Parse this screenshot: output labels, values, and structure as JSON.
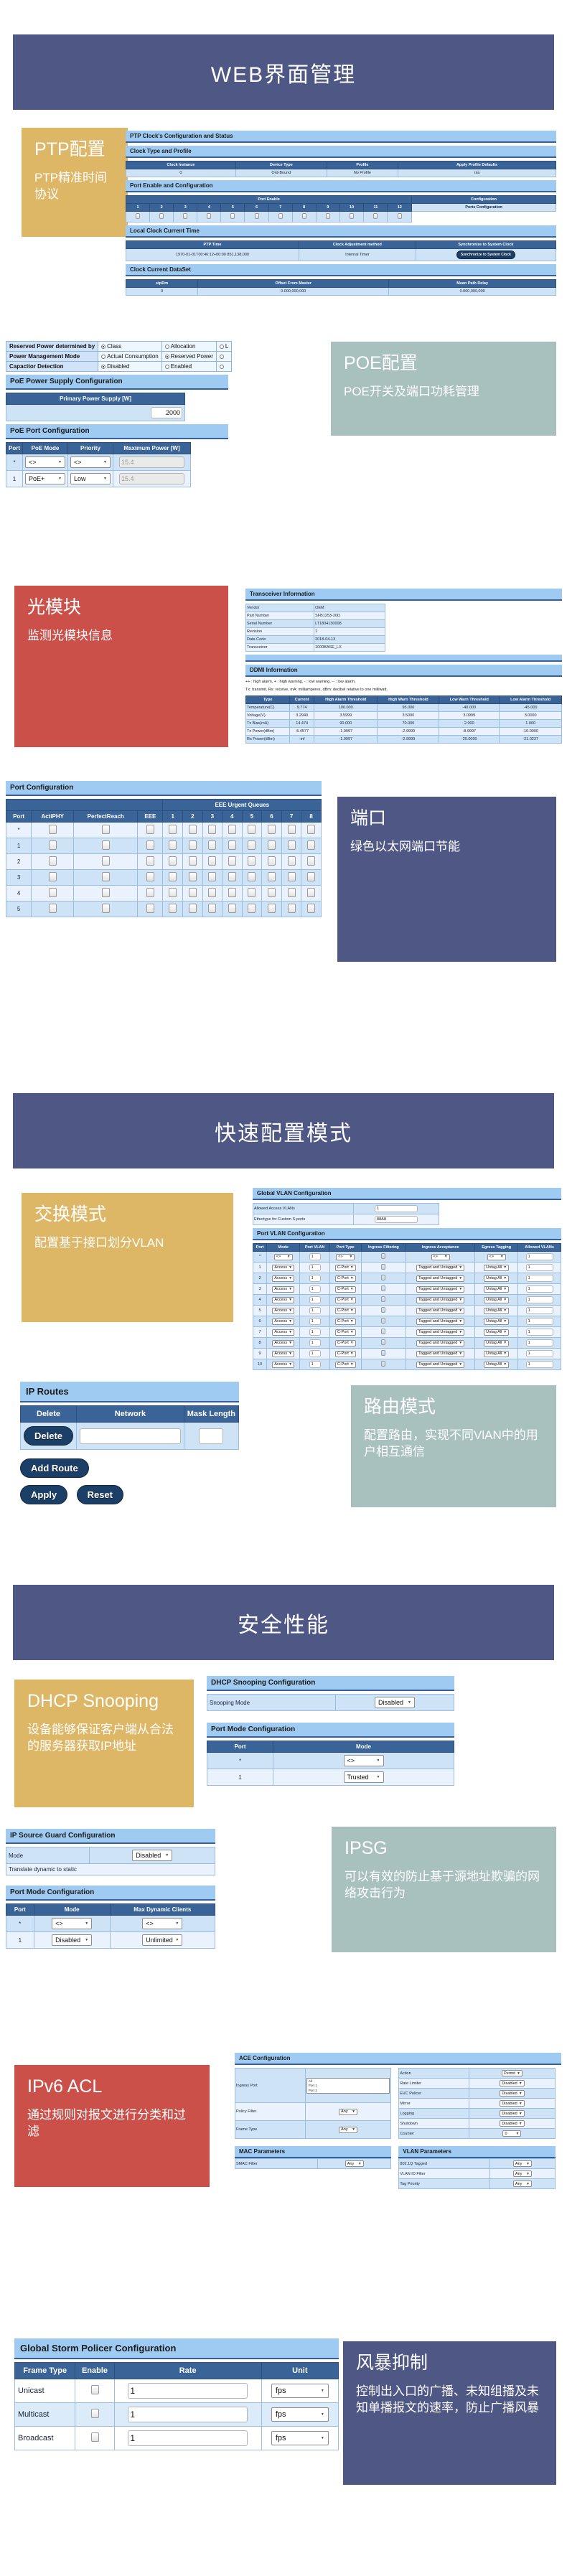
{
  "sections": [
    {
      "banner": "WEB界面管理"
    },
    {
      "banner": "快速配置模式"
    },
    {
      "banner": "安全性能"
    }
  ],
  "cards": {
    "ptp": {
      "title": "PTP配置",
      "sub": "PTP精准时间协议"
    },
    "poe": {
      "title": "POE配置",
      "sub": "POE开关及端口功耗管理"
    },
    "optic": {
      "title": "光模块",
      "sub": "监测光模块信息"
    },
    "port": {
      "title": "端口",
      "sub": "绿色以太网端口节能"
    },
    "switch": {
      "title": "交换模式",
      "sub": "配置基于接口划分VLAN"
    },
    "route": {
      "title": "路由模式",
      "sub": "配置路由，实现不同VlAN中的用户相互通信"
    },
    "dhcp": {
      "title": "DHCP Snooping",
      "sub": "设备能够保证客户端从合法的服务器获取IP地址"
    },
    "ipsg": {
      "title": "IPSG",
      "sub": "可以有效的防止基于源地址欺骗的网络攻击行为"
    },
    "acl": {
      "title": "IPv6 ACL",
      "sub": "通过规则对报文进行分类和过滤"
    },
    "storm": {
      "title": "风暴抑制",
      "sub": "控制出入口的广播、未知组播及未知单播报文的速率，防止广播风暴"
    }
  },
  "ptp": {
    "title": "PTP Clock's Configuration and Status",
    "clock_type_title": "Clock Type and Profile",
    "clock_type_headers": [
      "Clock Instance",
      "Device Type",
      "Profile",
      "Apply Profile Defaults"
    ],
    "clock_type_row": [
      "0",
      "Ord-Bound",
      "No Profile",
      "n/a"
    ],
    "port_enable_title": "Port Enable and Configuration",
    "port_enable_group": "Port Enable",
    "configuration_group": "Configuration",
    "ports": [
      "1",
      "2",
      "3",
      "4",
      "5",
      "6",
      "7",
      "8",
      "9",
      "10",
      "11",
      "12"
    ],
    "ports_config_label": "Ports Configuration",
    "local_clock_title": "Local Clock Current Time",
    "local_clock_headers": [
      "PTP Time",
      "Clock Adjustment method",
      "Synchronize to System Clock"
    ],
    "local_clock_time": "1970-01-01T00:46:12+00:00 851,138,000",
    "local_clock_method": "Internal Timer",
    "sync_button": "Synchronize to System Clock",
    "dataset_title": "Clock Current DataSet",
    "dataset_headers": [
      "stpRm",
      "Offset From Master",
      "Mean Path Delay"
    ],
    "dataset_row": [
      "0",
      "0.000,000,000",
      "0.000,000,000"
    ]
  },
  "poe": {
    "settings": [
      {
        "label": "Reserved Power determined by",
        "options": [
          {
            "text": "Class",
            "checked": true
          },
          {
            "text": "Allocation",
            "checked": false
          },
          {
            "text": "L",
            "checked": false
          }
        ]
      },
      {
        "label": "Power Management Mode",
        "options": [
          {
            "text": "Actual Consumption",
            "checked": false
          },
          {
            "text": "Reserved Power",
            "checked": true
          },
          {
            "text": "",
            "checked": false
          }
        ]
      },
      {
        "label": "Capacitor Detection",
        "options": [
          {
            "text": "Disabled",
            "checked": true
          },
          {
            "text": "Enabled",
            "checked": false
          },
          {
            "text": "",
            "checked": false
          }
        ]
      }
    ],
    "supply_title": "PoE Power Supply Configuration",
    "supply_header": "Primary Power Supply [W]",
    "supply_value": "2000",
    "port_title": "PoE Port Configuration",
    "port_headers": [
      "Port",
      "PoE Mode",
      "Priority",
      "Maximum Power [W]"
    ],
    "port_rows": [
      {
        "port": "*",
        "mode": "<>",
        "priority": "<>",
        "max": "15.4"
      },
      {
        "port": "1",
        "mode": "PoE+",
        "priority": "Low",
        "max": "15.4"
      }
    ]
  },
  "transceiver": {
    "title": "Transceiver Information",
    "rows": [
      [
        "Vendor",
        "OEM"
      ],
      [
        "Part Number",
        "SFB1253-20D"
      ],
      [
        "Serial Number",
        "LT1804130008"
      ],
      [
        "Revision",
        "1"
      ],
      [
        "Data Code",
        "2018-04-13"
      ],
      [
        "Transceiver",
        "1000BASE_LX"
      ]
    ],
    "ddmi_title": "DDMI Information",
    "legend1": "++ : high alarm, + : high warning, - : low warning, -- : low alarm.",
    "legend2": "Tx: transmit, Rx: receive, mA: milliamperes, dBm: decibel relative to one milliwatt.",
    "ddmi_headers": [
      "Type",
      "Current",
      "High Alarm Threshold",
      "High Warn Threshold",
      "Low Warn Threshold",
      "Low Alarm Threshold"
    ],
    "ddmi_rows": [
      [
        "Temperature(C)",
        "9.774",
        "100.000",
        "95.000",
        "-40.000",
        "-45.000"
      ],
      [
        "Voltage(V)",
        "3.2940",
        "3.5999",
        "3.5000",
        "3.0999",
        "3.0000"
      ],
      [
        "Tx Bias(mA)",
        "14.474",
        "90.000",
        "70.000",
        "2.000",
        "1.000"
      ],
      [
        "Tx Power(dBm)",
        "-5.4577",
        "-1.9997",
        "-2.9999",
        "-8.9997",
        "-10.0000"
      ],
      [
        "Rx Power(dBm)",
        "-inf",
        "-1.9997",
        "-2.9999",
        "-20.0000",
        "-21.0237"
      ]
    ]
  },
  "port_config": {
    "title": "Port Configuration",
    "group_header": "EEE Urgent Queues",
    "headers": [
      "Port",
      "ActiPHY",
      "PerfectReach",
      "EEE"
    ],
    "queues": [
      "1",
      "2",
      "3",
      "4",
      "5",
      "6",
      "7",
      "8"
    ],
    "rows": [
      "*",
      "1",
      "2",
      "3",
      "4",
      "5"
    ]
  },
  "vlan": {
    "global_title": "Global VLAN Configuration",
    "allowed_label": "Allowed Access VLANs",
    "allowed_value": "1",
    "ethertype_label": "Ethertype for Custom S-ports",
    "ethertype_value": "88A8",
    "port_title": "Port VLAN Configuration",
    "headers": [
      "Port",
      "Mode",
      "Port VLAN",
      "Port Type",
      "Ingress Filtering",
      "Ingress Acceptance",
      "Egress Tagging",
      "Allowed VLANs"
    ],
    "rows": [
      {
        "port": "*",
        "mode": "<>",
        "pvlan": "1",
        "ptype": "<>",
        "filter": true,
        "accept": "<>",
        "tag": "<>",
        "allowed": "1"
      },
      {
        "port": "1",
        "mode": "Access",
        "pvlan": "1",
        "ptype": "C-Port",
        "filter": true,
        "accept": "Tagged and Untagged",
        "tag": "Untag All",
        "allowed": "1"
      },
      {
        "port": "2",
        "mode": "Access",
        "pvlan": "1",
        "ptype": "C-Port",
        "filter": true,
        "accept": "Tagged and Untagged",
        "tag": "Untag All",
        "allowed": "1"
      },
      {
        "port": "3",
        "mode": "Access",
        "pvlan": "1",
        "ptype": "C-Port",
        "filter": true,
        "accept": "Tagged and Untagged",
        "tag": "Untag All",
        "allowed": "1"
      },
      {
        "port": "4",
        "mode": "Access",
        "pvlan": "1",
        "ptype": "C-Port",
        "filter": true,
        "accept": "Tagged and Untagged",
        "tag": "Untag All",
        "allowed": "1"
      },
      {
        "port": "5",
        "mode": "Access",
        "pvlan": "1",
        "ptype": "C-Port",
        "filter": true,
        "accept": "Tagged and Untagged",
        "tag": "Untag All",
        "allowed": "1"
      },
      {
        "port": "6",
        "mode": "Access",
        "pvlan": "1",
        "ptype": "C-Port",
        "filter": true,
        "accept": "Tagged and Untagged",
        "tag": "Untag All",
        "allowed": "1"
      },
      {
        "port": "7",
        "mode": "Access",
        "pvlan": "1",
        "ptype": "C-Port",
        "filter": true,
        "accept": "Tagged and Untagged",
        "tag": "Untag All",
        "allowed": "1"
      },
      {
        "port": "8",
        "mode": "Access",
        "pvlan": "1",
        "ptype": "C-Port",
        "filter": true,
        "accept": "Tagged and Untagged",
        "tag": "Untag All",
        "allowed": "1"
      },
      {
        "port": "9",
        "mode": "Access",
        "pvlan": "1",
        "ptype": "C-Port",
        "filter": true,
        "accept": "Tagged and Untagged",
        "tag": "Untag All",
        "allowed": "1"
      },
      {
        "port": "10",
        "mode": "Access",
        "pvlan": "1",
        "ptype": "C-Port",
        "filter": true,
        "accept": "Tagged and Untagged",
        "tag": "Untag All",
        "allowed": "1"
      }
    ]
  },
  "ip_routes": {
    "title": "IP Routes",
    "headers": [
      "Delete",
      "Network",
      "Mask Length"
    ],
    "delete_label": "Delete",
    "network_value": "",
    "mask_value": "",
    "add_route": "Add Route",
    "apply": "Apply",
    "reset": "Reset"
  },
  "dhcp_snooping": {
    "title": "DHCP Snooping Configuration",
    "mode_label": "Snooping Mode",
    "mode_value": "Disabled",
    "port_title": "Port Mode Configuration",
    "headers": [
      "Port",
      "Mode"
    ],
    "rows": [
      {
        "port": "*",
        "mode": "<>"
      },
      {
        "port": "1",
        "mode": "Trusted"
      }
    ]
  },
  "ipsg": {
    "title": "IP Source Guard Configuration",
    "mode_label": "Mode",
    "mode_value": "Disabled",
    "translate_label": "Translate dynamic to static",
    "port_title": "Port Mode Configuration",
    "headers": [
      "Port",
      "Mode",
      "Max Dynamic Clients"
    ],
    "rows": [
      {
        "port": "*",
        "mode": "<>",
        "max": "<>"
      },
      {
        "port": "1",
        "mode": "Disabled",
        "max": "Unlimited"
      }
    ]
  },
  "acl": {
    "title": "ACE Configuration",
    "left_rows": [
      {
        "label": "Ingress Port",
        "value": "All\nPort 1\nPort 2\nPort 3"
      },
      {
        "label": "Policy Filter",
        "value": "Any"
      },
      {
        "label": "Frame Type",
        "value": "Any"
      }
    ],
    "right_rows": [
      {
        "label": "Action",
        "value": "Permit"
      },
      {
        "label": "Rate Limiter",
        "value": "Disabled"
      },
      {
        "label": "EVC Policer",
        "value": "Disabled"
      },
      {
        "label": "Mirror",
        "value": "Disabled"
      },
      {
        "label": "Logging",
        "value": "Disabled"
      },
      {
        "label": "Shutdown",
        "value": "Disabled"
      },
      {
        "label": "Counter",
        "value": "0"
      }
    ],
    "mac_title": "MAC Parameters",
    "mac_rows": [
      {
        "label": "SMAC Filter",
        "value": "Any"
      }
    ],
    "vlan_title": "VLAN Parameters",
    "vlan_rows": [
      {
        "label": "802.1Q Tagged",
        "value": "Any"
      },
      {
        "label": "VLAN ID Filter",
        "value": "Any"
      },
      {
        "label": "Tag Priority",
        "value": "Any"
      }
    ]
  },
  "storm": {
    "title": "Global Storm Policer Configuration",
    "headers": [
      "Frame Type",
      "Enable",
      "Rate",
      "Unit"
    ],
    "rows": [
      {
        "type": "Unicast",
        "enable": false,
        "rate": "1",
        "unit": "fps"
      },
      {
        "type": "Multicast",
        "enable": false,
        "rate": "1",
        "unit": "fps"
      },
      {
        "type": "Broadcast",
        "enable": false,
        "rate": "1",
        "unit": "fps"
      }
    ]
  }
}
